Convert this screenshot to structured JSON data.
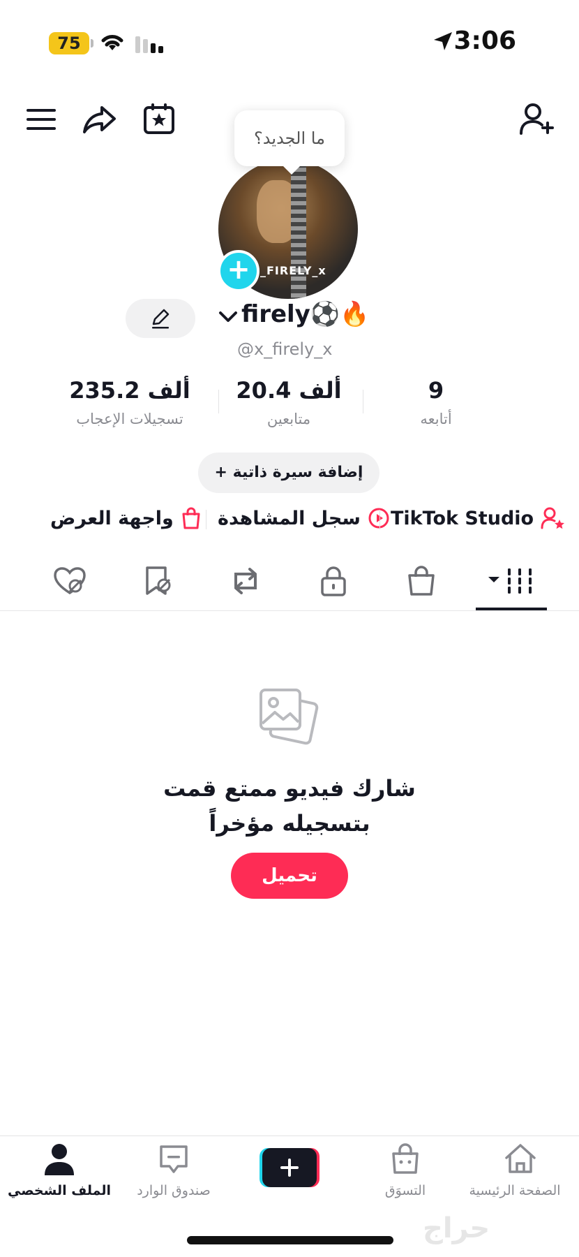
{
  "status_bar": {
    "battery": "75",
    "time": "3:06"
  },
  "tooltip": "ما الجديد؟",
  "avatar_label": "_FIRELY_x",
  "profile": {
    "name": "firely⚽🔥",
    "username": "@x_firely_x"
  },
  "stats": [
    {
      "value": "235.2 ألف",
      "label": "تسجيلات الإعجاب"
    },
    {
      "value": "20.4 ألف",
      "label": "متابعين"
    },
    {
      "value": "9",
      "label": "أتابعه"
    }
  ],
  "bio_button": "+ إضافة سيرة ذاتية",
  "links": {
    "showcase": "واجهة العرض",
    "watch_history": "سجل المشاهدة",
    "studio": "TikTok Studio"
  },
  "empty_state": {
    "title_line1": "شارك فيديو ممتع قمت",
    "title_line2": "بتسجيله مؤخراً",
    "button": "تحميل"
  },
  "bottom_nav": {
    "profile": "الملف الشخصي",
    "inbox": "صندوق الوارد",
    "shop": "التسوَق",
    "home": "الصفحة الرئيسية"
  },
  "watermark": "حراج",
  "colors": {
    "accent": "#fe2c55",
    "cyan": "#20d5ec",
    "text": "#161823",
    "muted": "#8a8b91"
  }
}
